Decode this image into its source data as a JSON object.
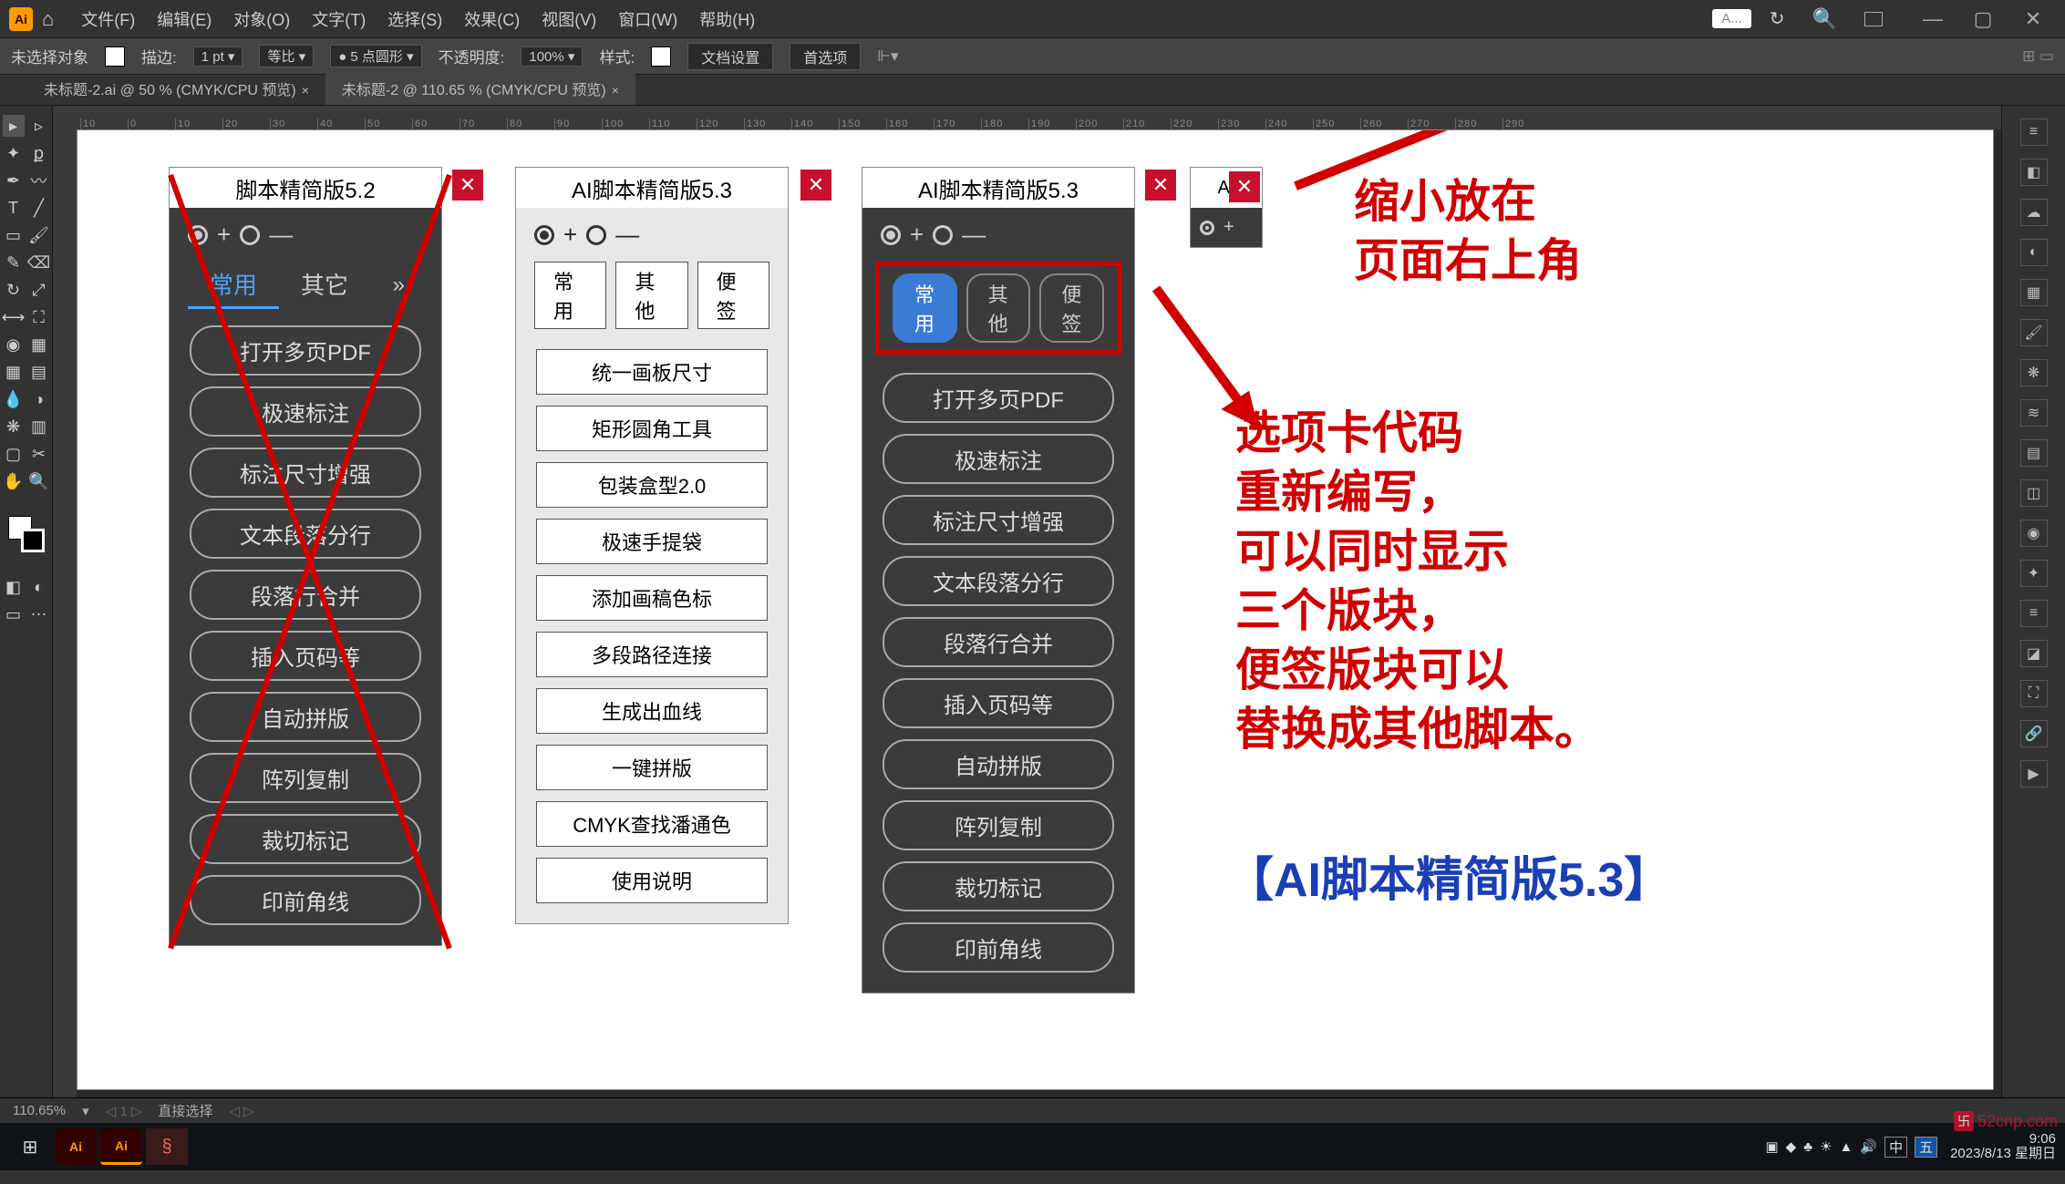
{
  "menubar": {
    "items": [
      "文件(F)",
      "编辑(E)",
      "对象(O)",
      "文字(T)",
      "选择(S)",
      "效果(C)",
      "视图(V)",
      "窗口(W)",
      "帮助(H)"
    ],
    "top_field": "A..."
  },
  "ctrlbar": {
    "nosel": "未选择对象",
    "stroke_lbl": "描边:",
    "stroke_val": "1 pt",
    "uniform": "等比",
    "brush_val": "5 点圆形",
    "opacity_lbl": "不透明度:",
    "opacity_val": "100%",
    "style_lbl": "样式:",
    "docset": "文档设置",
    "prefs": "首选项"
  },
  "tabs": {
    "t0": "未标题-2.ai @ 50 % (CMYK/CPU 预览)",
    "t1": "未标题-2 @ 110.65 % (CMYK/CPU 预览)"
  },
  "ruler_vals": [
    "10",
    "0",
    "10",
    "20",
    "30",
    "40",
    "50",
    "60",
    "70",
    "80",
    "90",
    "100",
    "110",
    "120",
    "130",
    "140",
    "150",
    "160",
    "170",
    "180",
    "190",
    "200",
    "210",
    "220",
    "230",
    "240",
    "250",
    "260",
    "270",
    "280",
    "290"
  ],
  "status": {
    "zoom": "110.65%",
    "sel": "直接选择"
  },
  "panel52": {
    "title": "脚本精简版5.2",
    "tabs": [
      "常用",
      "其它"
    ],
    "btns": [
      "打开多页PDF",
      "极速标注",
      "标注尺寸增强",
      "文本段落分行",
      "段落行合并",
      "插入页码等",
      "自动拼版",
      "阵列复制",
      "裁切标记",
      "印前角线"
    ]
  },
  "panel53light": {
    "title": "AI脚本精简版5.3",
    "tabs": [
      "常用",
      "其他",
      "便签"
    ],
    "btns": [
      "统一画板尺寸",
      "矩形圆角工具",
      "包装盒型2.0",
      "极速手提袋",
      "添加画稿色标",
      "多段路径连接",
      "生成出血线",
      "一键拼版",
      "CMYK查找潘通色",
      "使用说明"
    ]
  },
  "panel53dark": {
    "title": "AI脚本精简版5.3",
    "tabs": [
      "常用",
      "其他",
      "便签"
    ],
    "btns": [
      "打开多页PDF",
      "极速标注",
      "标注尺寸增强",
      "文本段落分行",
      "段落行合并",
      "插入页码等",
      "自动拼版",
      "阵列复制",
      "裁切标记",
      "印前角线"
    ]
  },
  "mini": {
    "title": "A."
  },
  "anno": {
    "a1_l1": "缩小放在",
    "a1_l2": "页面右上角",
    "a2_l1": "选项卡代码",
    "a2_l2": "重新编写，",
    "a2_l3": "可以同时显示",
    "a2_l4": "三个版块，",
    "a2_l5": "便签版块可以",
    "a2_l6": "替换成其他脚本。",
    "footer": "【AI脚本精简版5.3】"
  },
  "taskbar": {
    "time": "9:06",
    "date": "2023/8/13 星期日"
  },
  "watermark": "52cnp.com"
}
